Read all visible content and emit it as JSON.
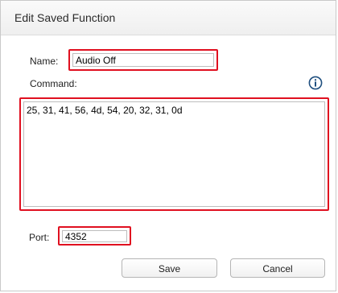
{
  "dialog": {
    "title": "Edit Saved Function"
  },
  "form": {
    "name_label": "Name:",
    "name_value": "Audio Off",
    "command_label": "Command:",
    "command_value": "25, 31, 41, 56, 4d, 54, 20, 32, 31, 0d",
    "port_label": "Port:",
    "port_value": "4352"
  },
  "icons": {
    "info": "info-icon"
  },
  "buttons": {
    "save_label": "Save",
    "cancel_label": "Cancel"
  },
  "colors": {
    "highlight": "#e01020",
    "info_icon": "#1f4f7f"
  }
}
